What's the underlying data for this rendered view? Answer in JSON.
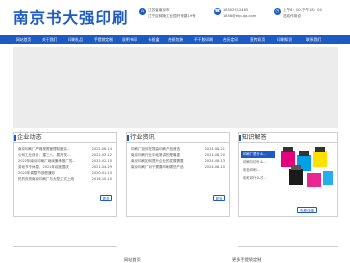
{
  "header": {
    "logo": "南京书大强印刷",
    "address_line1": "江苏省南京市",
    "address_line2": "江宁区秣陵工业园开来路19号",
    "phone": "18502512465",
    "email": "1858@mp-qq.com",
    "hours": "上午8：00-下午18：00",
    "welcome": "送欢作用设"
  },
  "nav": [
    "网站首页",
    "关于我们",
    "印刷礼品",
    "手提袋定制",
    "说明书印",
    "卡纸盒",
    "合纸包装",
    "不干胶印刷",
    "台历定印",
    "宣传彩页",
    "印刷知识",
    "联系我们"
  ],
  "panels": {
    "company": {
      "title": "企业动态",
      "items": [
        {
          "title": "南京印刷厂严格按照管理制度实...",
          "date": "2022-06-14"
        },
        {
          "title": "公司工业设计、建三八、展开关...",
          "date": "2022-03-12"
        },
        {
          "title": "2022年南京印刷厂继续秉承推广的...",
          "date": "2022-02-10"
        },
        {
          "title": "劳动节不休息，2021年欢度国庆",
          "date": "2021-04-29"
        },
        {
          "title": "2020年调整节放假通知",
          "date": "2020-01-10"
        },
        {
          "title": "热烈庆祝南京印刷厂与大型工式上线",
          "date": "2016-10-10"
        }
      ],
      "more": "更多"
    },
    "industry": {
      "title": "行业资讯",
      "items": [
        {
          "title": "印刷厂如何在提高印刷产品首选",
          "date": "2024-08-21"
        },
        {
          "title": "南京印刷行业中经常讲的是最重",
          "date": "2024-08-20"
        },
        {
          "title": "南京印刷如何提升企业的发展需要",
          "date": "2024-08-13"
        },
        {
          "title": "南京印刷厂对于需要印刷哪些产品",
          "date": "2024-08-10"
        }
      ],
      "more": "更多"
    },
    "knowledge": {
      "title": "知识解答",
      "items": [
        "印刷厂是什么...",
        "印刷与印什么...",
        "彩色印刷...",
        "彩虹印什么才..."
      ],
      "more": "查看详情"
    }
  },
  "footer": {
    "left": "网站首页",
    "right": "更多手提袋定制"
  },
  "colors": {
    "brand": "#1d5bc4",
    "banner": "#ececec"
  }
}
